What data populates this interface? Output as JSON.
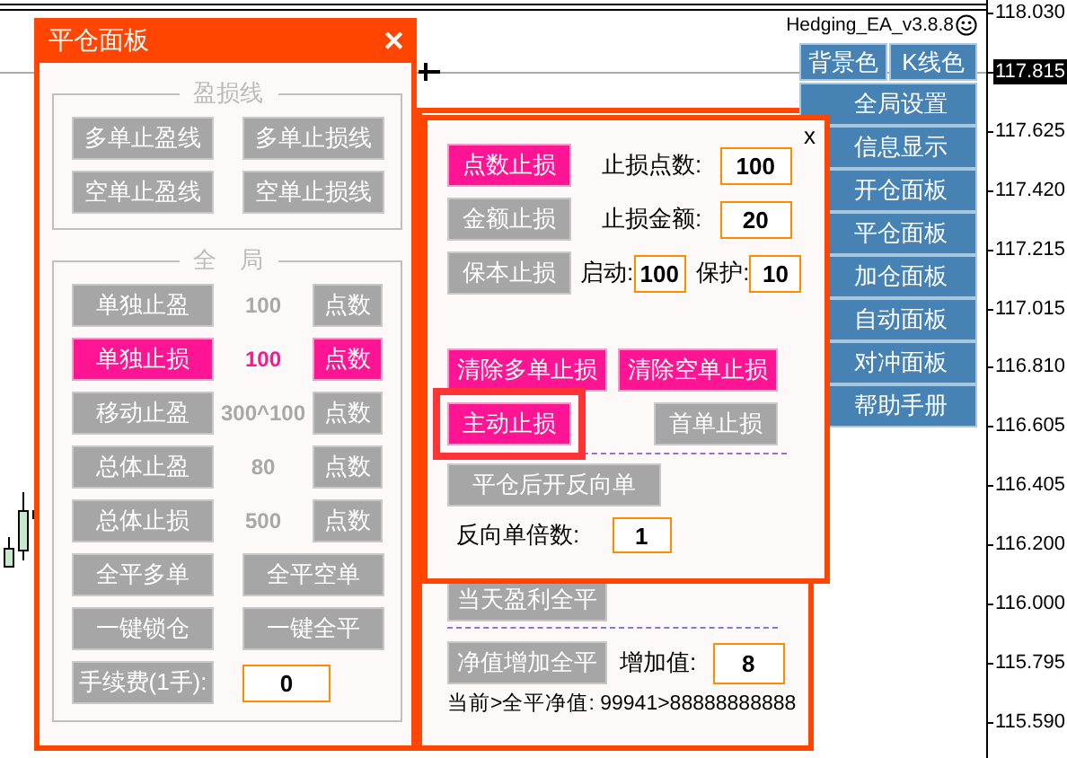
{
  "chart": {
    "indicator": "Hedging_EA_v3.8.8",
    "price_axis": [
      {
        "label": "118.030",
        "current": false
      },
      {
        "label": "117.815",
        "current": true
      },
      {
        "label": "117.625",
        "current": false
      },
      {
        "label": "117.420",
        "current": false
      },
      {
        "label": "117.215",
        "current": false
      },
      {
        "label": "117.015",
        "current": false
      },
      {
        "label": "116.810",
        "current": false
      },
      {
        "label": "116.605",
        "current": false
      },
      {
        "label": "116.405",
        "current": false
      },
      {
        "label": "116.200",
        "current": false
      },
      {
        "label": "116.000",
        "current": false
      },
      {
        "label": "115.795",
        "current": false
      },
      {
        "label": "115.590",
        "current": false
      }
    ]
  },
  "close_panel": {
    "title": "平仓面板",
    "close": "✕",
    "pl_lines": {
      "legend": "盈损线",
      "buttons": [
        {
          "label": "多单止盈线",
          "active": false
        },
        {
          "label": "多单止损线",
          "active": false
        },
        {
          "label": "空单止盈线",
          "active": false
        },
        {
          "label": "空单止损线",
          "active": false
        }
      ]
    },
    "global": {
      "legend": "全　局",
      "rows": [
        {
          "kind": "setting",
          "label": "单独止盈",
          "value": "100",
          "unit": "点数",
          "active": false
        },
        {
          "kind": "setting",
          "label": "单独止损",
          "value": "100",
          "unit": "点数",
          "active": true
        },
        {
          "kind": "setting",
          "label": "移动止盈",
          "value": "300^100",
          "unit": "点数",
          "active": false
        },
        {
          "kind": "setting",
          "label": "总体止盈",
          "value": "80",
          "unit": "点数",
          "active": false
        },
        {
          "kind": "setting",
          "label": "总体止损",
          "value": "500",
          "unit": "点数",
          "active": false
        },
        {
          "kind": "pair",
          "buttons": [
            {
              "label": "全平多单",
              "active": false
            },
            {
              "label": "全平空单",
              "active": false
            }
          ]
        },
        {
          "kind": "pair",
          "buttons": [
            {
              "label": "一键锁仓",
              "active": false
            },
            {
              "label": "一键全平",
              "active": false
            }
          ]
        },
        {
          "kind": "fee",
          "label": "手续费(1手):",
          "value": "0"
        }
      ]
    }
  },
  "back_panel": {
    "daily_button": {
      "label": "当天盈利全平",
      "active": false
    },
    "equity_button": {
      "label": "净值增加全平",
      "active": false
    },
    "increase": {
      "label": "增加值:",
      "value": "8"
    },
    "status": "当前>全平净值: 99941>88888888888"
  },
  "stop_panel": {
    "close": "x",
    "modes": [
      {
        "kind": "single",
        "button": "点数止损",
        "active": true,
        "label": "止损点数:",
        "value": "100"
      },
      {
        "kind": "single",
        "button": "金额止损",
        "active": false,
        "label": "止损金额:",
        "value": "20"
      },
      {
        "kind": "double",
        "button": "保本止损",
        "active": false,
        "fields": [
          {
            "label": "启动:",
            "value": "100"
          },
          {
            "label": "保护:",
            "value": "10"
          }
        ]
      }
    ],
    "clear_buttons": [
      {
        "label": "清除多单止损",
        "active": true
      },
      {
        "label": "清除空单止损",
        "active": true
      }
    ],
    "mode_buttons": [
      {
        "label": "主动止损",
        "active": true,
        "focused": true
      },
      {
        "label": "首单止损",
        "active": false,
        "focused": false
      }
    ],
    "reverse_button": {
      "label": "平仓后开反向单",
      "active": false
    },
    "multiplier": {
      "label": "反向单倍数:",
      "value": "1"
    }
  },
  "menu": {
    "top": [
      "背景色",
      "K线色"
    ],
    "items": [
      "全局设置",
      "信息显示",
      "开仓面板",
      "平仓面板",
      "加仓面板",
      "自动面板",
      "对冲面板",
      "帮助手册"
    ]
  }
}
